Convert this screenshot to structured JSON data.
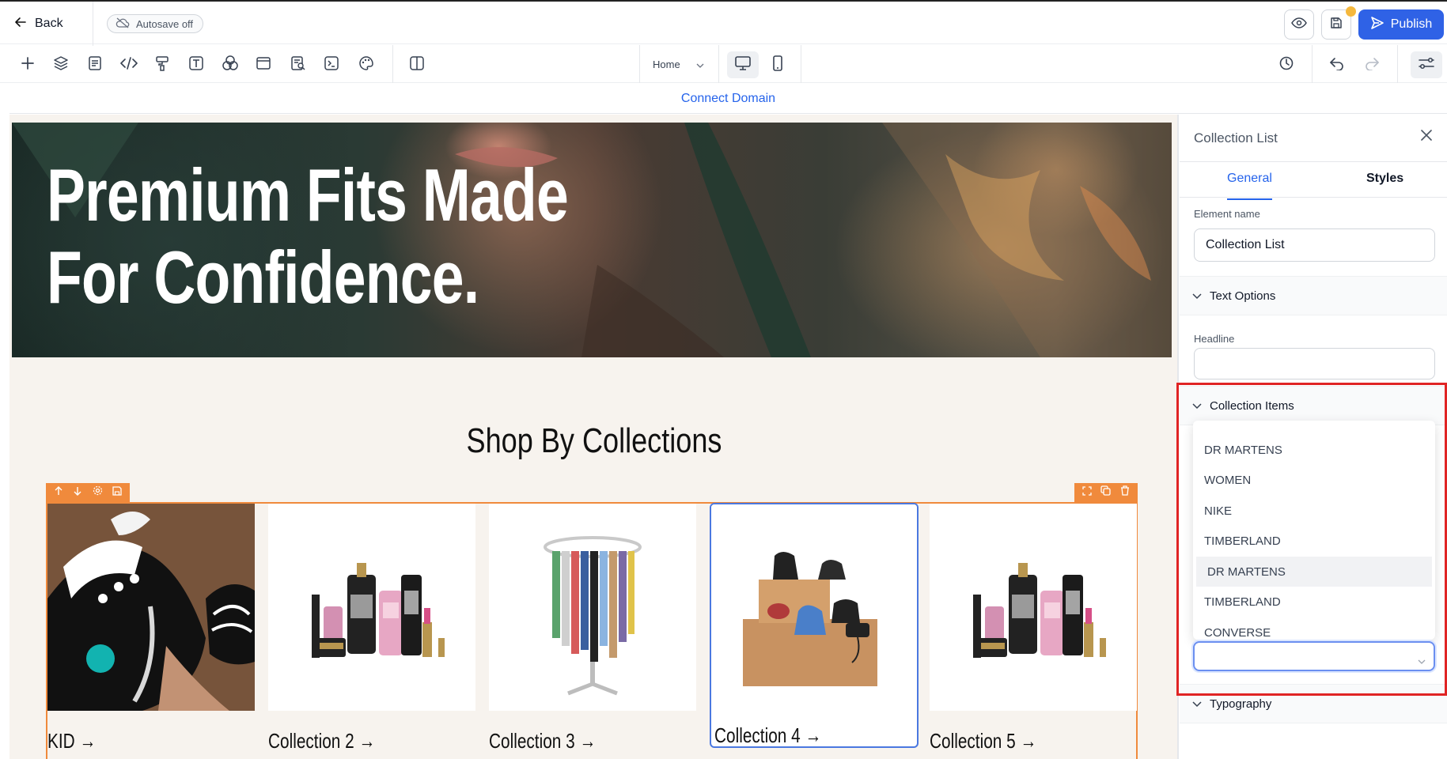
{
  "topbar": {
    "back_label": "Back",
    "autosave_label": "Autosave off",
    "publish_label": "Publish"
  },
  "toolbar": {
    "page_select": "Home",
    "icons": [
      "plus-icon",
      "layers-icon",
      "pages-icon",
      "code-icon",
      "paint-roller-icon",
      "text-icon",
      "shapes-icon",
      "section-icon",
      "seo-icon",
      "terminal-icon",
      "palette-icon",
      "split-view-icon"
    ]
  },
  "domain_bar": {
    "link": "Connect Domain"
  },
  "canvas": {
    "hero_line1": "Premium Fits Made",
    "hero_line2": "For Confidence.",
    "section_title": "Shop By Collections",
    "cards": [
      {
        "label": "KID →",
        "image": "sneakers-photo"
      },
      {
        "label": "Collection 2 →",
        "image": "cosmetics-illustration"
      },
      {
        "label": "Collection 3 →",
        "image": "clothing-rack-illustration"
      },
      {
        "label": "Collection 4 →",
        "image": "bags-illustration"
      },
      {
        "label": "Collection 5 →",
        "image": "cosmetics-illustration"
      }
    ]
  },
  "panel": {
    "title": "Collection List",
    "tabs": [
      "General",
      "Styles"
    ],
    "element_name_label": "Element name",
    "element_name_value": "Collection List",
    "text_options": "Text Options",
    "headline_label": "Headline",
    "headline_value": "",
    "collection_items": "Collection Items",
    "dropdown_options": [
      "DR MARTENS",
      "WOMEN",
      "NIKE",
      "TIMBERLAND",
      "DR MARTENS",
      "TIMBERLAND",
      "CONVERSE"
    ],
    "select_value": "",
    "typography": "Typography"
  },
  "colors": {
    "accent": "#2f62e6",
    "selection_orange": "#f08a3c",
    "highlight_red": "#e02424",
    "link_blue": "#2563eb",
    "canvas_bg": "#f7f3ee"
  }
}
